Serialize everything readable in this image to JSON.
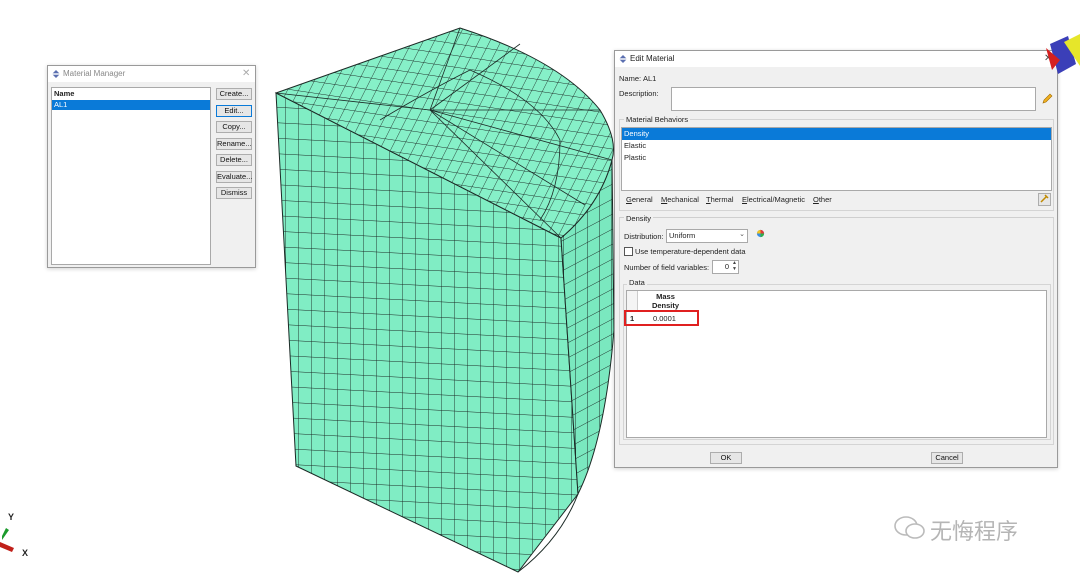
{
  "material_manager": {
    "title": "Material Manager",
    "column_header": "Name",
    "materials": [
      "AL1"
    ],
    "buttons": [
      "Create...",
      "Edit...",
      "Copy...",
      "Rename...",
      "Delete...",
      "Evaluate...",
      "Dismiss"
    ]
  },
  "edit_material": {
    "title": "Edit Material",
    "name_label": "Name:",
    "name_value": "AL1",
    "description_label": "Description:",
    "description_value": "",
    "behaviors_header": "Material Behaviors",
    "behaviors": [
      "Density",
      "Elastic",
      "Plastic"
    ],
    "menu": [
      "General",
      "Mechanical",
      "Thermal",
      "Electrical/Magnetic",
      "Other"
    ],
    "section_title": "Density",
    "distribution_label": "Distribution:",
    "distribution_value": "Uniform",
    "temp_dependent_label": "Use temperature-dependent data",
    "temp_dependent_checked": false,
    "field_vars_label": "Number of field variables:",
    "field_vars_value": "0",
    "data_label": "Data",
    "table": {
      "header_line1": "Mass",
      "header_line2": "Density",
      "rows": [
        {
          "index": "1",
          "value": "0.0001"
        }
      ]
    },
    "ok_label": "OK",
    "cancel_label": "Cancel"
  },
  "triad": {
    "y_label": "Y",
    "x_label": "X"
  },
  "watermark": "无悔程序",
  "colors": {
    "mesh_fill": "#7fecc3",
    "mesh_line": "#1c2a26",
    "selection": "#0a7ad8",
    "highlight_box": "#e02020"
  }
}
